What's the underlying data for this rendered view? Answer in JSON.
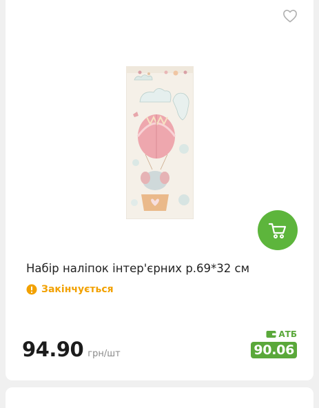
{
  "product": {
    "title": "Набір наліпок інтер'єрних р.69*32 см",
    "stock_status": "Закінчується",
    "price": "94.90",
    "price_unit": "грн/шт",
    "club_brand": "АТБ",
    "club_price": "90.06"
  },
  "icons": {
    "favorite": "heart-outline-icon",
    "cart": "shopping-cart-icon",
    "warning": "exclamation-circle-icon",
    "wallet": "wallet-card-icon"
  },
  "colors": {
    "accent_green": "#5db53c",
    "club_green": "#5aa83a",
    "warning_orange": "#f2a100",
    "heart_gray": "#b0b0b0"
  }
}
